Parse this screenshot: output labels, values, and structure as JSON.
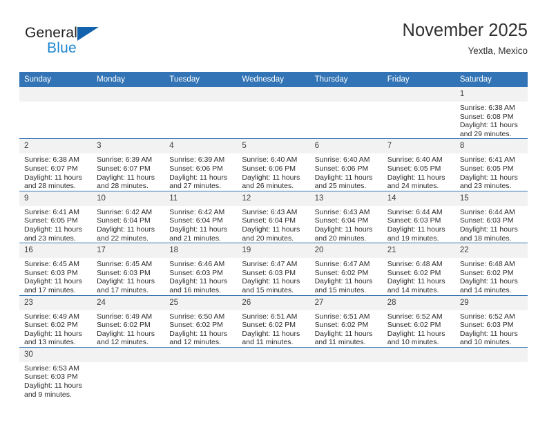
{
  "brand": {
    "name_top": "General",
    "name_bottom": "Blue",
    "triangle_color": "#1362ad",
    "blue_text_color": "#1d85d0"
  },
  "header": {
    "title": "November 2025",
    "subtitle": "Yextla, Mexico"
  },
  "colors": {
    "header_row_background": "#3274b5",
    "header_row_text": "#ffffff",
    "daynum_background": "#f2f2f2",
    "cell_background": "#ffffff",
    "row_divider": "#3274b5"
  },
  "calendar": {
    "weekday_headers": [
      "Sunday",
      "Monday",
      "Tuesday",
      "Wednesday",
      "Thursday",
      "Friday",
      "Saturday"
    ],
    "labels": {
      "sunrise": "Sunrise:",
      "sunset": "Sunset:",
      "daylight": "Daylight:"
    },
    "weeks": [
      [
        {
          "day": ""
        },
        {
          "day": ""
        },
        {
          "day": ""
        },
        {
          "day": ""
        },
        {
          "day": ""
        },
        {
          "day": ""
        },
        {
          "day": "1",
          "sunrise": "Sunrise: 6:38 AM",
          "sunset": "Sunset: 6:08 PM",
          "daylight_1": "Daylight: 11 hours",
          "daylight_2": "and 29 minutes."
        }
      ],
      [
        {
          "day": "2",
          "sunrise": "Sunrise: 6:38 AM",
          "sunset": "Sunset: 6:07 PM",
          "daylight_1": "Daylight: 11 hours",
          "daylight_2": "and 28 minutes."
        },
        {
          "day": "3",
          "sunrise": "Sunrise: 6:39 AM",
          "sunset": "Sunset: 6:07 PM",
          "daylight_1": "Daylight: 11 hours",
          "daylight_2": "and 28 minutes."
        },
        {
          "day": "4",
          "sunrise": "Sunrise: 6:39 AM",
          "sunset": "Sunset: 6:06 PM",
          "daylight_1": "Daylight: 11 hours",
          "daylight_2": "and 27 minutes."
        },
        {
          "day": "5",
          "sunrise": "Sunrise: 6:40 AM",
          "sunset": "Sunset: 6:06 PM",
          "daylight_1": "Daylight: 11 hours",
          "daylight_2": "and 26 minutes."
        },
        {
          "day": "6",
          "sunrise": "Sunrise: 6:40 AM",
          "sunset": "Sunset: 6:06 PM",
          "daylight_1": "Daylight: 11 hours",
          "daylight_2": "and 25 minutes."
        },
        {
          "day": "7",
          "sunrise": "Sunrise: 6:40 AM",
          "sunset": "Sunset: 6:05 PM",
          "daylight_1": "Daylight: 11 hours",
          "daylight_2": "and 24 minutes."
        },
        {
          "day": "8",
          "sunrise": "Sunrise: 6:41 AM",
          "sunset": "Sunset: 6:05 PM",
          "daylight_1": "Daylight: 11 hours",
          "daylight_2": "and 23 minutes."
        }
      ],
      [
        {
          "day": "9",
          "sunrise": "Sunrise: 6:41 AM",
          "sunset": "Sunset: 6:05 PM",
          "daylight_1": "Daylight: 11 hours",
          "daylight_2": "and 23 minutes."
        },
        {
          "day": "10",
          "sunrise": "Sunrise: 6:42 AM",
          "sunset": "Sunset: 6:04 PM",
          "daylight_1": "Daylight: 11 hours",
          "daylight_2": "and 22 minutes."
        },
        {
          "day": "11",
          "sunrise": "Sunrise: 6:42 AM",
          "sunset": "Sunset: 6:04 PM",
          "daylight_1": "Daylight: 11 hours",
          "daylight_2": "and 21 minutes."
        },
        {
          "day": "12",
          "sunrise": "Sunrise: 6:43 AM",
          "sunset": "Sunset: 6:04 PM",
          "daylight_1": "Daylight: 11 hours",
          "daylight_2": "and 20 minutes."
        },
        {
          "day": "13",
          "sunrise": "Sunrise: 6:43 AM",
          "sunset": "Sunset: 6:04 PM",
          "daylight_1": "Daylight: 11 hours",
          "daylight_2": "and 20 minutes."
        },
        {
          "day": "14",
          "sunrise": "Sunrise: 6:44 AM",
          "sunset": "Sunset: 6:03 PM",
          "daylight_1": "Daylight: 11 hours",
          "daylight_2": "and 19 minutes."
        },
        {
          "day": "15",
          "sunrise": "Sunrise: 6:44 AM",
          "sunset": "Sunset: 6:03 PM",
          "daylight_1": "Daylight: 11 hours",
          "daylight_2": "and 18 minutes."
        }
      ],
      [
        {
          "day": "16",
          "sunrise": "Sunrise: 6:45 AM",
          "sunset": "Sunset: 6:03 PM",
          "daylight_1": "Daylight: 11 hours",
          "daylight_2": "and 17 minutes."
        },
        {
          "day": "17",
          "sunrise": "Sunrise: 6:45 AM",
          "sunset": "Sunset: 6:03 PM",
          "daylight_1": "Daylight: 11 hours",
          "daylight_2": "and 17 minutes."
        },
        {
          "day": "18",
          "sunrise": "Sunrise: 6:46 AM",
          "sunset": "Sunset: 6:03 PM",
          "daylight_1": "Daylight: 11 hours",
          "daylight_2": "and 16 minutes."
        },
        {
          "day": "19",
          "sunrise": "Sunrise: 6:47 AM",
          "sunset": "Sunset: 6:03 PM",
          "daylight_1": "Daylight: 11 hours",
          "daylight_2": "and 15 minutes."
        },
        {
          "day": "20",
          "sunrise": "Sunrise: 6:47 AM",
          "sunset": "Sunset: 6:02 PM",
          "daylight_1": "Daylight: 11 hours",
          "daylight_2": "and 15 minutes."
        },
        {
          "day": "21",
          "sunrise": "Sunrise: 6:48 AM",
          "sunset": "Sunset: 6:02 PM",
          "daylight_1": "Daylight: 11 hours",
          "daylight_2": "and 14 minutes."
        },
        {
          "day": "22",
          "sunrise": "Sunrise: 6:48 AM",
          "sunset": "Sunset: 6:02 PM",
          "daylight_1": "Daylight: 11 hours",
          "daylight_2": "and 14 minutes."
        }
      ],
      [
        {
          "day": "23",
          "sunrise": "Sunrise: 6:49 AM",
          "sunset": "Sunset: 6:02 PM",
          "daylight_1": "Daylight: 11 hours",
          "daylight_2": "and 13 minutes."
        },
        {
          "day": "24",
          "sunrise": "Sunrise: 6:49 AM",
          "sunset": "Sunset: 6:02 PM",
          "daylight_1": "Daylight: 11 hours",
          "daylight_2": "and 12 minutes."
        },
        {
          "day": "25",
          "sunrise": "Sunrise: 6:50 AM",
          "sunset": "Sunset: 6:02 PM",
          "daylight_1": "Daylight: 11 hours",
          "daylight_2": "and 12 minutes."
        },
        {
          "day": "26",
          "sunrise": "Sunrise: 6:51 AM",
          "sunset": "Sunset: 6:02 PM",
          "daylight_1": "Daylight: 11 hours",
          "daylight_2": "and 11 minutes."
        },
        {
          "day": "27",
          "sunrise": "Sunrise: 6:51 AM",
          "sunset": "Sunset: 6:02 PM",
          "daylight_1": "Daylight: 11 hours",
          "daylight_2": "and 11 minutes."
        },
        {
          "day": "28",
          "sunrise": "Sunrise: 6:52 AM",
          "sunset": "Sunset: 6:02 PM",
          "daylight_1": "Daylight: 11 hours",
          "daylight_2": "and 10 minutes."
        },
        {
          "day": "29",
          "sunrise": "Sunrise: 6:52 AM",
          "sunset": "Sunset: 6:03 PM",
          "daylight_1": "Daylight: 11 hours",
          "daylight_2": "and 10 minutes."
        }
      ],
      [
        {
          "day": "30",
          "sunrise": "Sunrise: 6:53 AM",
          "sunset": "Sunset: 6:03 PM",
          "daylight_1": "Daylight: 11 hours",
          "daylight_2": "and 9 minutes."
        },
        {
          "day": ""
        },
        {
          "day": ""
        },
        {
          "day": ""
        },
        {
          "day": ""
        },
        {
          "day": ""
        },
        {
          "day": ""
        }
      ]
    ]
  }
}
